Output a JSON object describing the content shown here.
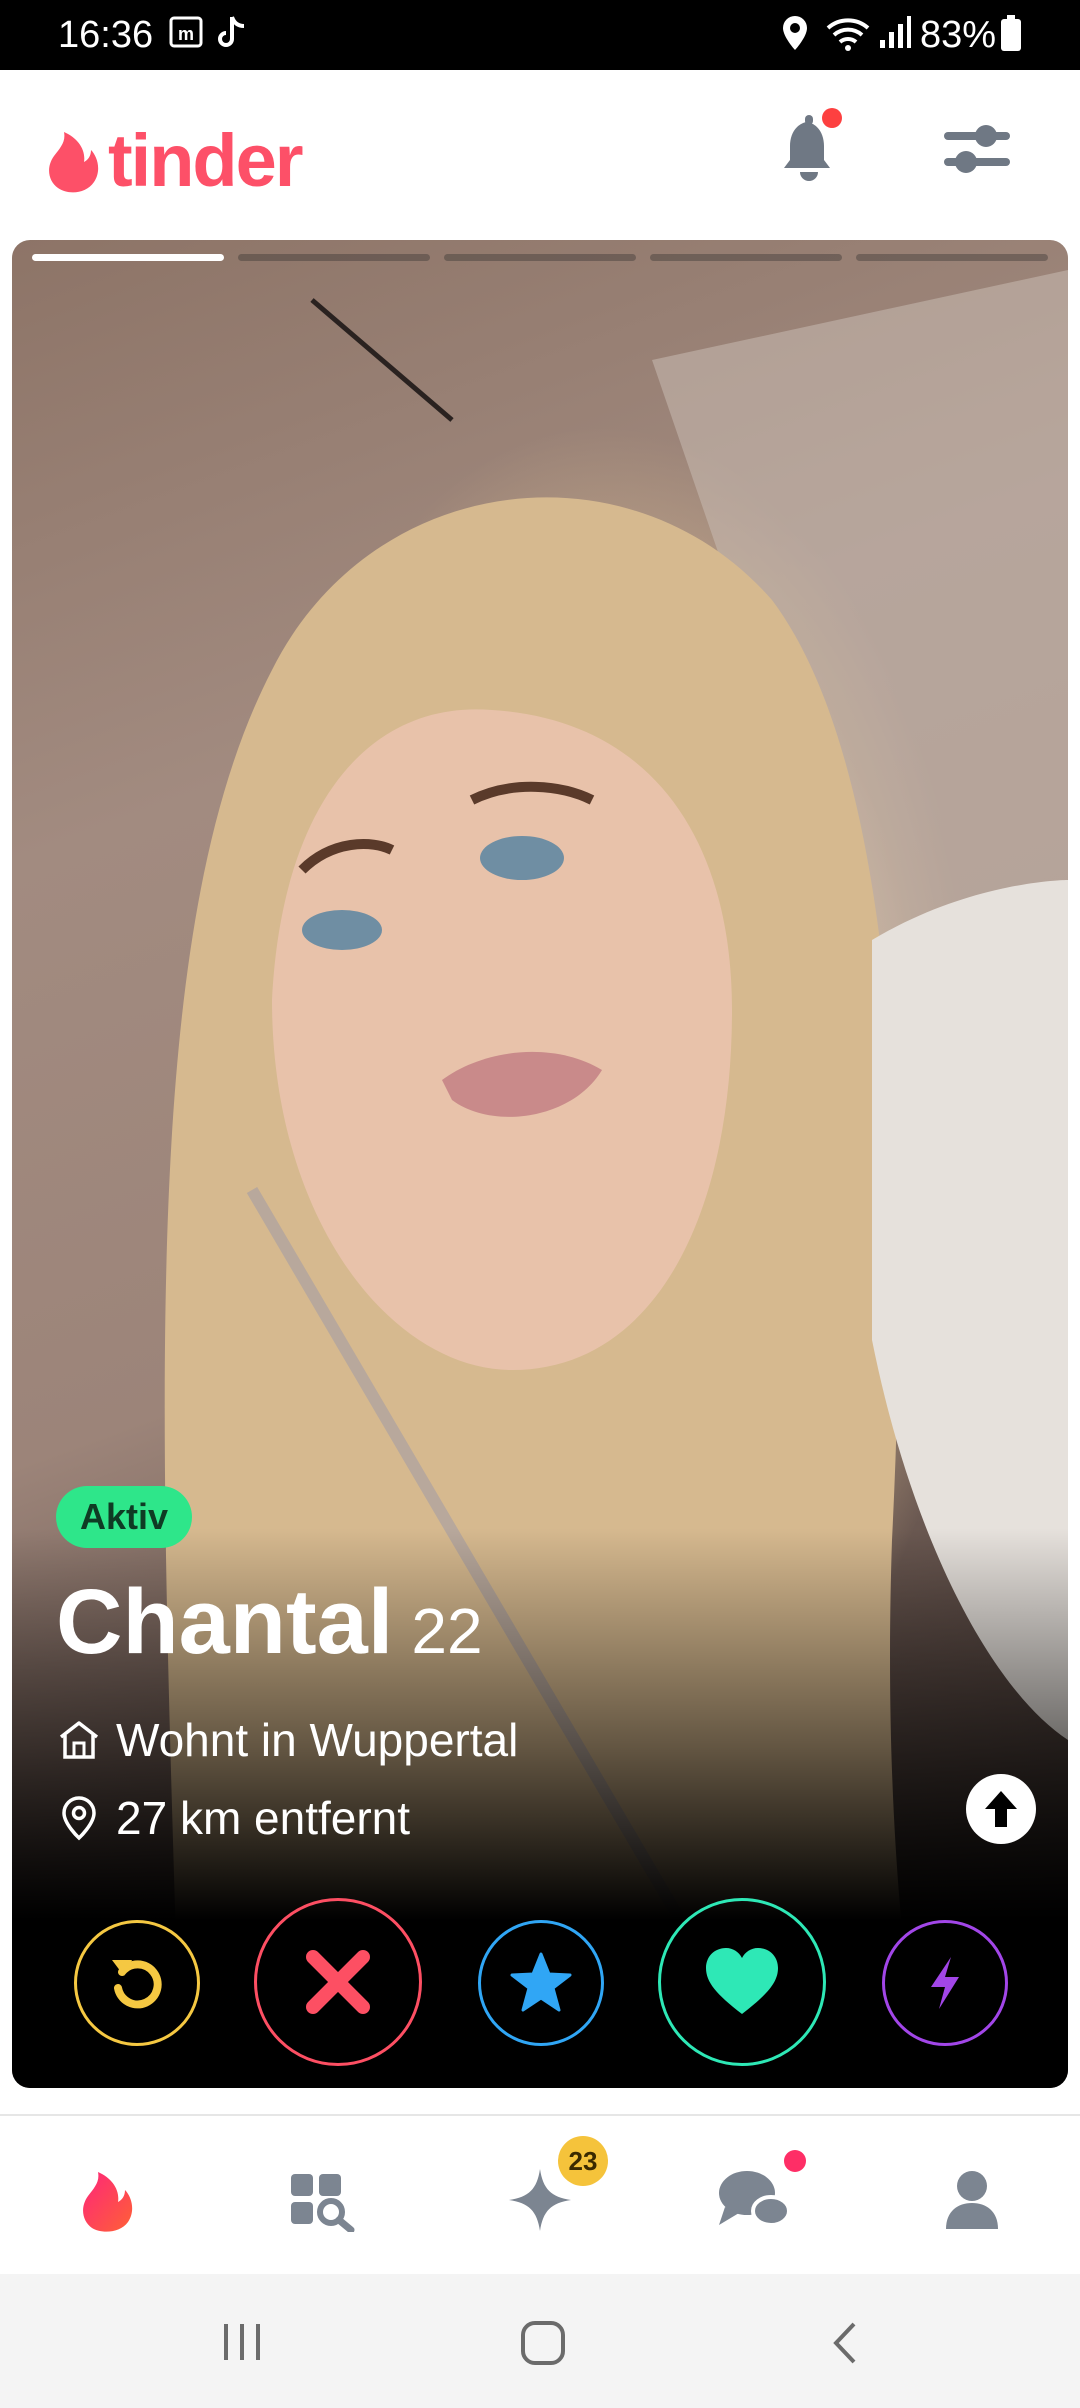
{
  "status_bar": {
    "time": "16:36",
    "battery": "83%"
  },
  "header": {
    "app_name": "tinder"
  },
  "profile": {
    "active_badge": "Aktiv",
    "name": "Chantal",
    "age": "22",
    "lives_in": "Wohnt in Wuppertal",
    "distance": "27 km entfernt",
    "photo_count": 5,
    "current_photo": 1
  },
  "actions": [
    {
      "name": "rewind",
      "icon": "rewind-icon",
      "color": "#f5c842"
    },
    {
      "name": "nope",
      "icon": "x-icon",
      "color": "#fd4f63"
    },
    {
      "name": "super-like",
      "icon": "star-icon",
      "color": "#30a6f5"
    },
    {
      "name": "like",
      "icon": "heart-icon",
      "color": "#2ee8b6"
    },
    {
      "name": "boost",
      "icon": "bolt-icon",
      "color": "#a246e8"
    }
  ],
  "bottom_nav": {
    "items": [
      "flame-icon",
      "explore-icon",
      "sparkle-icon",
      "chat-icon",
      "profile-icon"
    ],
    "likes_badge": "23"
  },
  "colors": {
    "brand": "#fd5068",
    "active_green": "#2ee68a"
  }
}
